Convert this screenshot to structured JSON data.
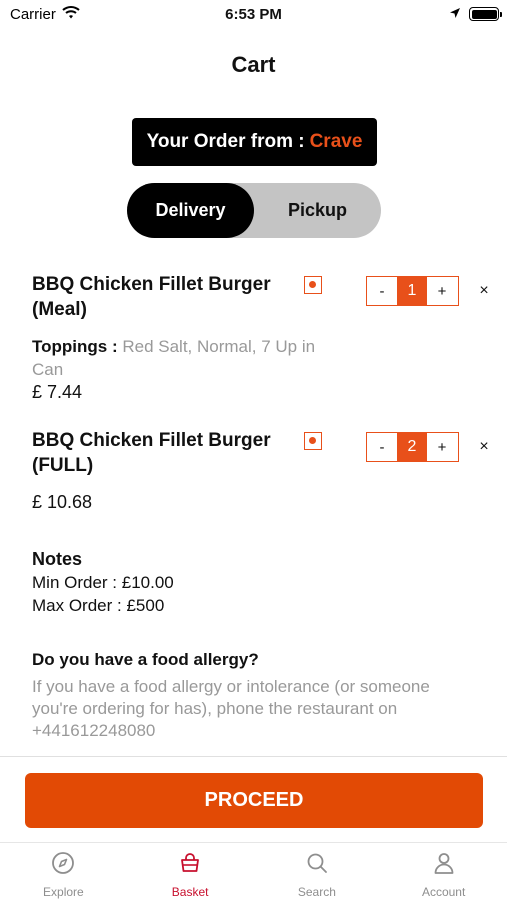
{
  "status_bar": {
    "carrier": "Carrier",
    "time": "6:53 PM"
  },
  "nav": {
    "title": "Cart"
  },
  "order_from": {
    "prefix": "Your Order from :",
    "restaurant": "Crave"
  },
  "mode_toggle": {
    "delivery": "Delivery",
    "pickup": "Pickup",
    "selected": "Delivery"
  },
  "items": [
    {
      "name": "BBQ Chicken Fillet Burger (Meal)",
      "quantity": "1",
      "toppings_label": "Toppings :",
      "toppings_value": "Red Salt, Normal, 7 Up in Can",
      "price": "£ 7.44"
    },
    {
      "name": "BBQ Chicken Fillet Burger (FULL)",
      "quantity": "2",
      "price": "£ 10.68"
    }
  ],
  "stepper": {
    "minus": "-",
    "plus": "+",
    "remove": "×"
  },
  "notes": {
    "title": "Notes",
    "min_order": "Min Order : £10.00",
    "max_order": "Max Order : £500"
  },
  "allergy": {
    "title": "Do you have a food allergy?",
    "body": "If you have a food allergy or intolerance (or someone you're ordering for has), phone the restaurant on  +441612248080"
  },
  "proceed_label": "PROCEED",
  "tabs": [
    {
      "label": "Explore",
      "icon": "compass-icon"
    },
    {
      "label": "Basket",
      "icon": "basket-icon",
      "active": true
    },
    {
      "label": "Search",
      "icon": "search-icon"
    },
    {
      "label": "Account",
      "icon": "account-icon"
    }
  ],
  "colors": {
    "accent": "#e24a05",
    "active_tab": "#c8102e",
    "dark": "#000000"
  }
}
